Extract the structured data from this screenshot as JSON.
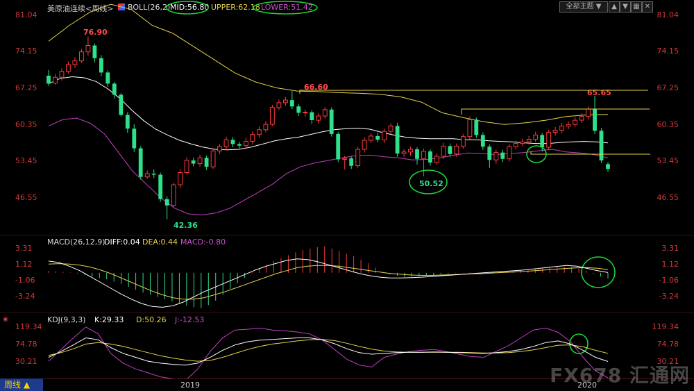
{
  "header": {
    "instrument": "美原油连续<周线>",
    "boll_label": "BOLL(26,2)",
    "mid": "MID:56.80",
    "upper": "UPPER:62.18",
    "lower": "LOWER:51.42",
    "theme_select": "全部主题",
    "colors": {
      "mid": "#ffffff",
      "upper": "#e8d44d",
      "lower": "#c040c0",
      "up": "#ff3b3b",
      "down": "#2ee08a",
      "circle": "#1fd13a"
    }
  },
  "price_axis": {
    "ticks": [
      "81.04",
      "74.15",
      "67.25",
      "60.35",
      "53.45",
      "46.55"
    ]
  },
  "macd": {
    "label": "MACD(26,12,9)",
    "diff": "DIFF:0.04",
    "dea": "DEA:0.44",
    "macd": "MACD:-0.80",
    "ticks": [
      "3.31",
      "1.12",
      "-1.06",
      "-3.24"
    ]
  },
  "kdj": {
    "label": "KDJ(9,3,3)",
    "k": "K:29.33",
    "d": "D:50.26",
    "j": "J:-12.53",
    "ticks": [
      "119.34",
      "74.78",
      "30.21"
    ]
  },
  "xaxis": {
    "years": [
      "2019",
      "2020"
    ]
  },
  "annotations": {
    "high1": "76.90",
    "low1": "42.36",
    "high2": "66.60",
    "low2": "50.52",
    "high3": "65.65"
  },
  "footer": {
    "period_tab": "周线 ▲",
    "watermark": "FX678 汇通网"
  },
  "chart_data": {
    "type": "candlestick",
    "title": "美原油连续<周线>",
    "ylim": [
      42,
      82
    ],
    "candles": [
      [
        69.5,
        68.0,
        70.6,
        67.6
      ],
      [
        68.1,
        69.2,
        69.8,
        67.8
      ],
      [
        69.2,
        70.3,
        70.9,
        68.6
      ],
      [
        70.3,
        71.6,
        72.2,
        69.9
      ],
      [
        71.6,
        72.3,
        73.0,
        71.0
      ],
      [
        72.3,
        74.0,
        74.6,
        71.9
      ],
      [
        74.0,
        75.2,
        76.9,
        73.3
      ],
      [
        75.2,
        72.8,
        75.6,
        72.0
      ],
      [
        72.8,
        70.1,
        73.4,
        69.4
      ],
      [
        70.1,
        68.0,
        70.5,
        67.4
      ],
      [
        68.0,
        65.9,
        68.3,
        65.2
      ],
      [
        65.9,
        62.1,
        66.2,
        61.8
      ],
      [
        62.1,
        59.5,
        62.6,
        58.7
      ],
      [
        59.5,
        55.8,
        60.3,
        55.1
      ],
      [
        55.8,
        50.4,
        56.2,
        49.9
      ],
      [
        50.4,
        51.0,
        51.6,
        50.0
      ],
      [
        51.0,
        50.8,
        51.8,
        50.2
      ],
      [
        50.8,
        46.2,
        51.2,
        45.7
      ],
      [
        46.2,
        45.0,
        46.7,
        42.4
      ],
      [
        45.0,
        48.9,
        49.3,
        44.6
      ],
      [
        48.9,
        51.2,
        51.8,
        48.3
      ],
      [
        51.2,
        53.5,
        54.1,
        50.8
      ],
      [
        53.5,
        52.9,
        54.0,
        52.4
      ],
      [
        52.9,
        54.0,
        54.6,
        52.3
      ],
      [
        54.0,
        52.3,
        54.4,
        51.7
      ],
      [
        52.3,
        55.3,
        55.8,
        51.9
      ],
      [
        55.3,
        56.1,
        56.6,
        54.7
      ],
      [
        56.1,
        57.4,
        58.0,
        55.5
      ],
      [
        57.4,
        56.6,
        57.9,
        56.0
      ],
      [
        56.6,
        56.3,
        57.0,
        55.8
      ],
      [
        56.3,
        57.1,
        57.8,
        55.7
      ],
      [
        57.1,
        58.4,
        59.0,
        56.5
      ],
      [
        58.4,
        59.3,
        59.9,
        57.8
      ],
      [
        59.3,
        60.3,
        60.9,
        58.8
      ],
      [
        60.3,
        63.5,
        64.0,
        60.0
      ],
      [
        63.5,
        64.4,
        65.0,
        63.0
      ],
      [
        64.4,
        64.9,
        65.5,
        63.8
      ],
      [
        64.9,
        63.7,
        66.6,
        63.2
      ],
      [
        63.7,
        62.5,
        64.1,
        61.9
      ],
      [
        62.5,
        62.6,
        63.1,
        61.8
      ],
      [
        62.6,
        61.1,
        63.0,
        60.4
      ],
      [
        61.1,
        61.9,
        62.4,
        60.5
      ],
      [
        61.9,
        63.1,
        63.6,
        61.4
      ],
      [
        63.1,
        58.5,
        63.5,
        58.0
      ],
      [
        58.5,
        53.7,
        58.9,
        53.2
      ],
      [
        53.7,
        53.9,
        54.4,
        51.8
      ],
      [
        53.9,
        52.5,
        54.2,
        51.9
      ],
      [
        52.5,
        55.6,
        56.1,
        52.1
      ],
      [
        55.6,
        57.3,
        57.9,
        55.0
      ],
      [
        57.3,
        58.1,
        58.6,
        56.8
      ],
      [
        58.1,
        57.4,
        58.7,
        56.9
      ],
      [
        57.4,
        59.0,
        59.5,
        56.8
      ],
      [
        59.0,
        60.0,
        60.5,
        58.5
      ],
      [
        60.0,
        54.8,
        60.6,
        54.2
      ],
      [
        54.8,
        55.1,
        55.6,
        54.2
      ],
      [
        55.1,
        55.6,
        56.1,
        54.4
      ],
      [
        55.6,
        53.8,
        56.0,
        52.7
      ],
      [
        53.8,
        55.2,
        55.7,
        50.5
      ],
      [
        55.2,
        53.1,
        55.6,
        52.5
      ],
      [
        53.1,
        54.3,
        54.9,
        52.7
      ],
      [
        54.3,
        56.2,
        56.8,
        53.8
      ],
      [
        56.2,
        54.7,
        56.7,
        54.1
      ],
      [
        54.7,
        56.2,
        56.7,
        54.2
      ],
      [
        56.2,
        58.0,
        58.5,
        55.7
      ],
      [
        58.0,
        61.2,
        61.8,
        57.5
      ],
      [
        61.2,
        58.3,
        61.6,
        57.7
      ],
      [
        58.3,
        56.1,
        58.8,
        55.5
      ],
      [
        56.1,
        53.6,
        56.5,
        52.1
      ],
      [
        53.6,
        55.0,
        55.5,
        52.9
      ],
      [
        55.0,
        53.8,
        55.5,
        53.2
      ],
      [
        53.8,
        56.1,
        56.6,
        53.3
      ],
      [
        56.1,
        56.7,
        57.2,
        55.6
      ],
      [
        56.7,
        57.0,
        57.6,
        56.2
      ],
      [
        57.0,
        57.5,
        58.1,
        56.5
      ],
      [
        57.5,
        58.3,
        58.9,
        57.0
      ],
      [
        58.3,
        56.0,
        58.7,
        55.2
      ],
      [
        56.0,
        58.8,
        59.3,
        55.5
      ],
      [
        58.8,
        59.2,
        59.8,
        58.2
      ],
      [
        59.2,
        60.0,
        60.6,
        58.6
      ],
      [
        60.0,
        60.3,
        60.9,
        59.4
      ],
      [
        60.3,
        61.1,
        61.7,
        59.8
      ],
      [
        61.1,
        61.8,
        62.4,
        60.6
      ],
      [
        61.8,
        63.2,
        63.7,
        61.2
      ],
      [
        63.2,
        59.1,
        65.7,
        58.5
      ],
      [
        59.1,
        53.5,
        59.6,
        53.0
      ],
      [
        52.8,
        51.9,
        53.2,
        51.4
      ]
    ],
    "boll_mid": [
      68,
      69,
      69.3,
      69.1,
      68.4,
      67,
      65.2,
      63,
      61,
      59.4,
      58.3,
      57.3,
      56.6,
      56,
      55.6,
      55.5,
      55.6,
      56,
      56.6,
      57.2,
      57.6,
      57.9,
      58.4,
      58.9,
      59.3,
      59.5,
      59.6,
      59.4,
      58.8,
      58.3,
      57.9,
      57.7,
      57.6,
      57.6,
      57.6,
      57.4,
      57.4,
      57.2,
      57.1,
      57,
      56.8,
      56.7,
      56.7,
      56.9,
      57,
      57.1,
      57,
      56.8
    ],
    "boll_upper": [
      76,
      79,
      81.5,
      83,
      82,
      79,
      77.5,
      75,
      72.5,
      70,
      68.3,
      67.2,
      66.6,
      66.5,
      66.3,
      66.2,
      66,
      65.5,
      64.5,
      62.5,
      61.6,
      60.8,
      60.3,
      60.6,
      61.1,
      61.8,
      62.1,
      62.2
    ],
    "boll_lower": [
      60,
      61.2,
      61.5,
      60.5,
      58.5,
      55,
      51.5,
      49,
      46.5,
      44.5,
      43.4,
      43.2,
      43.6,
      44.5,
      46,
      47.5,
      49,
      51,
      52.3,
      53,
      53.5,
      54,
      54.4,
      54.5,
      54.2,
      54,
      53.6,
      53.7,
      54,
      54.5,
      54.9,
      54.8,
      54.6,
      54.8,
      55,
      55.3,
      55.6,
      55.1,
      54.9,
      54.6,
      54
    ],
    "macd_hist": [
      0.25,
      0.2,
      0.12,
      0.05,
      -0.1,
      -0.3,
      -0.5,
      -0.7,
      -0.9,
      -1.2,
      -1.5,
      -1.9,
      -2.3,
      -2.7,
      -3.0,
      -3.3,
      -3.6,
      -3.9,
      -4.2,
      -4.5,
      -4.7,
      -4.8,
      -4.4,
      -3.8,
      -3.0,
      -2.2,
      -1.4,
      -0.7,
      0.1,
      0.6,
      1.1,
      1.6,
      2.0,
      2.4,
      2.8,
      3.1,
      3.3,
      3.5,
      3.6,
      3.3,
      3.0,
      2.6,
      2.3,
      1.8,
      1.3,
      0.7,
      0.1,
      -0.2,
      -0.4,
      -0.55,
      -0.5,
      -0.45,
      -0.35,
      -0.3,
      -0.2,
      -0.12,
      -0.05,
      0.02,
      0.05,
      0.05,
      0.04,
      0.06,
      0.1,
      0.16,
      0.24,
      0.33,
      0.42,
      0.5,
      0.6,
      0.7,
      0.78,
      0.84,
      0.8,
      0.6,
      0.3,
      -0.1,
      -0.5,
      -0.8
    ],
    "macd_diff": [
      1.6,
      1.4,
      0.9,
      0.3,
      -0.5,
      -1.3,
      -2.1,
      -2.9,
      -3.6,
      -4.2,
      -4.6,
      -4.7,
      -4.5,
      -4.0,
      -3.3,
      -2.6,
      -2.0,
      -1.4,
      -0.8,
      -0.2,
      0.4,
      0.9,
      1.3,
      1.7,
      1.9,
      1.8,
      1.5,
      1.1,
      0.7,
      0.3,
      -0.1,
      -0.4,
      -0.6,
      -0.7,
      -0.7,
      -0.65,
      -0.6,
      -0.5,
      -0.4,
      -0.3,
      -0.2,
      -0.1,
      0,
      0.1,
      0.2,
      0.3,
      0.4,
      0.55,
      0.7,
      0.85,
      1.0,
      0.9,
      0.6,
      0.3,
      0.04
    ],
    "macd_dea": [
      1.2,
      1.25,
      1.2,
      1.05,
      0.8,
      0.4,
      -0.1,
      -0.7,
      -1.3,
      -1.9,
      -2.5,
      -3.0,
      -3.4,
      -3.6,
      -3.6,
      -3.4,
      -3.0,
      -2.6,
      -2.1,
      -1.6,
      -1.1,
      -0.6,
      -0.1,
      0.3,
      0.7,
      0.9,
      1.0,
      1.0,
      0.9,
      0.7,
      0.5,
      0.3,
      0.1,
      -0.1,
      -0.2,
      -0.3,
      -0.35,
      -0.35,
      -0.3,
      -0.25,
      -0.2,
      -0.15,
      -0.1,
      -0.02,
      0.05,
      0.12,
      0.2,
      0.3,
      0.4,
      0.5,
      0.6,
      0.68,
      0.7,
      0.62,
      0.44
    ],
    "kdj_k": [
      40,
      55,
      72,
      90,
      85,
      65,
      50,
      40,
      30,
      25,
      22,
      20,
      25,
      40,
      58,
      72,
      80,
      84,
      86,
      88,
      90,
      90,
      85,
      75,
      62,
      52,
      48,
      50,
      52,
      53,
      53,
      54,
      53,
      52,
      51,
      50,
      52,
      55,
      60,
      68,
      78,
      82,
      74,
      58,
      40,
      29.33
    ],
    "kdj_d": [
      45,
      52,
      62,
      74,
      78,
      74,
      68,
      60,
      52,
      44,
      38,
      33,
      30,
      32,
      40,
      50,
      60,
      68,
      74,
      78,
      82,
      85,
      86,
      83,
      76,
      68,
      61,
      56,
      54,
      53,
      53,
      53,
      53,
      53,
      52,
      51,
      51,
      52,
      55,
      59,
      65,
      71,
      72,
      67,
      58,
      50.26
    ],
    "kdj_j": [
      30,
      60,
      90,
      118,
      100,
      50,
      25,
      10,
      0,
      -10,
      -15,
      -20,
      10,
      55,
      90,
      110,
      112,
      115,
      110,
      108,
      105,
      100,
      85,
      60,
      35,
      20,
      15,
      40,
      48,
      55,
      58,
      60,
      55,
      48,
      42,
      40,
      55,
      70,
      90,
      110,
      115,
      104,
      80,
      40,
      5,
      -12.53
    ]
  }
}
